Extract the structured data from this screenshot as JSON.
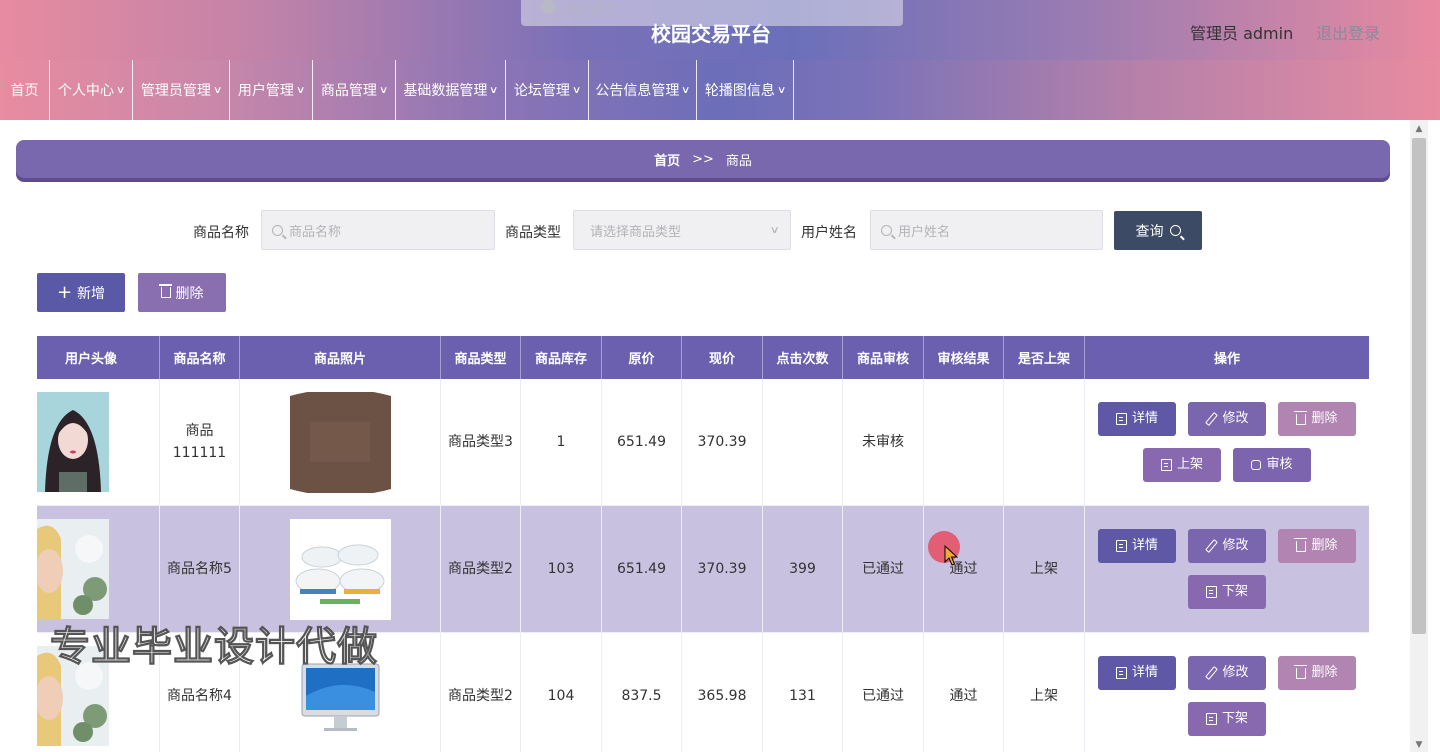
{
  "header": {
    "toast_text": "操作成功",
    "site_title": "校园交易平台",
    "admin_label": "管理员 admin",
    "logout_label": "退出登录"
  },
  "nav": {
    "items": [
      {
        "label": "首页",
        "has_dropdown": false
      },
      {
        "label": "个人中心",
        "has_dropdown": true
      },
      {
        "label": "管理员管理",
        "has_dropdown": true
      },
      {
        "label": "用户管理",
        "has_dropdown": true
      },
      {
        "label": "商品管理",
        "has_dropdown": true
      },
      {
        "label": "基础数据管理",
        "has_dropdown": true
      },
      {
        "label": "论坛管理",
        "has_dropdown": true
      },
      {
        "label": "公告信息管理",
        "has_dropdown": true
      },
      {
        "label": "轮播图信息",
        "has_dropdown": true
      }
    ]
  },
  "breadcrumb": {
    "home": "首页",
    "sep": ">>",
    "current": "商品"
  },
  "search": {
    "name_label": "商品名称",
    "name_placeholder": "商品名称",
    "type_label": "商品类型",
    "type_placeholder": "请选择商品类型",
    "user_label": "用户姓名",
    "user_placeholder": "用户姓名",
    "query_label": "查询"
  },
  "actions": {
    "add_label": "新增",
    "delete_label": "删除"
  },
  "table": {
    "headers": [
      "用户头像",
      "商品名称",
      "商品照片",
      "商品类型",
      "商品库存",
      "原价",
      "现价",
      "点击次数",
      "商品审核",
      "审核结果",
      "是否上架",
      "操作"
    ],
    "rows": [
      {
        "name": "商品111111",
        "type": "商品类型3",
        "stock": "1",
        "orig_price": "651.49",
        "price": "370.39",
        "clicks": "",
        "audit": "未审核",
        "audit_result": "",
        "on_shelf": "",
        "extra_buttons": [
          "上架",
          "审核"
        ]
      },
      {
        "name": "商品名称5",
        "type": "商品类型2",
        "stock": "103",
        "orig_price": "651.49",
        "price": "370.39",
        "clicks": "399",
        "audit": "已通过",
        "audit_result": "通过",
        "on_shelf": "上架",
        "extra_buttons": [
          "下架"
        ]
      },
      {
        "name": "商品名称4",
        "type": "商品类型2",
        "stock": "104",
        "orig_price": "837.5",
        "price": "365.98",
        "clicks": "131",
        "audit": "已通过",
        "audit_result": "通过",
        "on_shelf": "上架",
        "extra_buttons": [
          "下架"
        ]
      }
    ],
    "op_labels": {
      "detail": "详情",
      "edit": "修改",
      "delete": "删除"
    }
  },
  "watermark": "专业毕业设计代做",
  "colors": {
    "header_purple": "#6b6fba",
    "header_pink": "#e88aa0",
    "table_header": "#6b5fb0",
    "highlight_row": "#c8c2e0"
  }
}
